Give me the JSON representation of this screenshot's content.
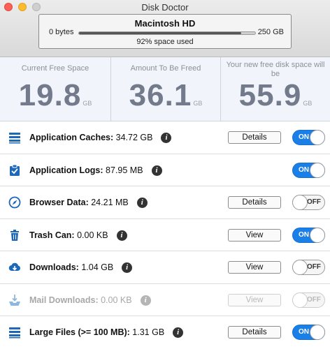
{
  "window": {
    "title": "Disk Doctor"
  },
  "disk": {
    "name": "Macintosh HD",
    "min_label": "0 bytes",
    "max_label": "250 GB",
    "used_fraction": 0.92,
    "used_label": "92% space used"
  },
  "stats": [
    {
      "label": "Current Free Space",
      "value": "19.8",
      "unit": "GB"
    },
    {
      "label": "Amount To Be Freed",
      "value": "36.1",
      "unit": "GB"
    },
    {
      "label": "Your new free disk space will be",
      "value": "55.9",
      "unit": "GB"
    }
  ],
  "rows": [
    {
      "name": "Application Caches:",
      "size": "34.72 GB",
      "action": "Details",
      "toggle": "ON",
      "icon": "stack-icon"
    },
    {
      "name": "Application Logs:",
      "size": "87.95 MB",
      "action": "",
      "toggle": "ON",
      "icon": "clipboard-check-icon"
    },
    {
      "name": "Browser Data:",
      "size": "24.21 MB",
      "action": "Details",
      "toggle": "OFF",
      "icon": "compass-icon"
    },
    {
      "name": "Trash Can:",
      "size": "0.00 KB",
      "action": "View",
      "toggle": "ON",
      "icon": "trash-icon"
    },
    {
      "name": "Downloads:",
      "size": "1.04 GB",
      "action": "View",
      "toggle": "OFF",
      "icon": "cloud-download-icon"
    },
    {
      "name": "Mail Downloads:",
      "size": "0.00 KB",
      "action": "View",
      "toggle": "OFF",
      "icon": "tray-download-icon",
      "disabled": true
    },
    {
      "name": "Large Files (>= 100 MB):",
      "size": "1.31 GB",
      "action": "Details",
      "toggle": "ON",
      "icon": "stack-icon"
    }
  ],
  "colors": {
    "accent": "#1b7fe8",
    "stat_value": "#737a8c",
    "icon": "#1d68b8"
  }
}
